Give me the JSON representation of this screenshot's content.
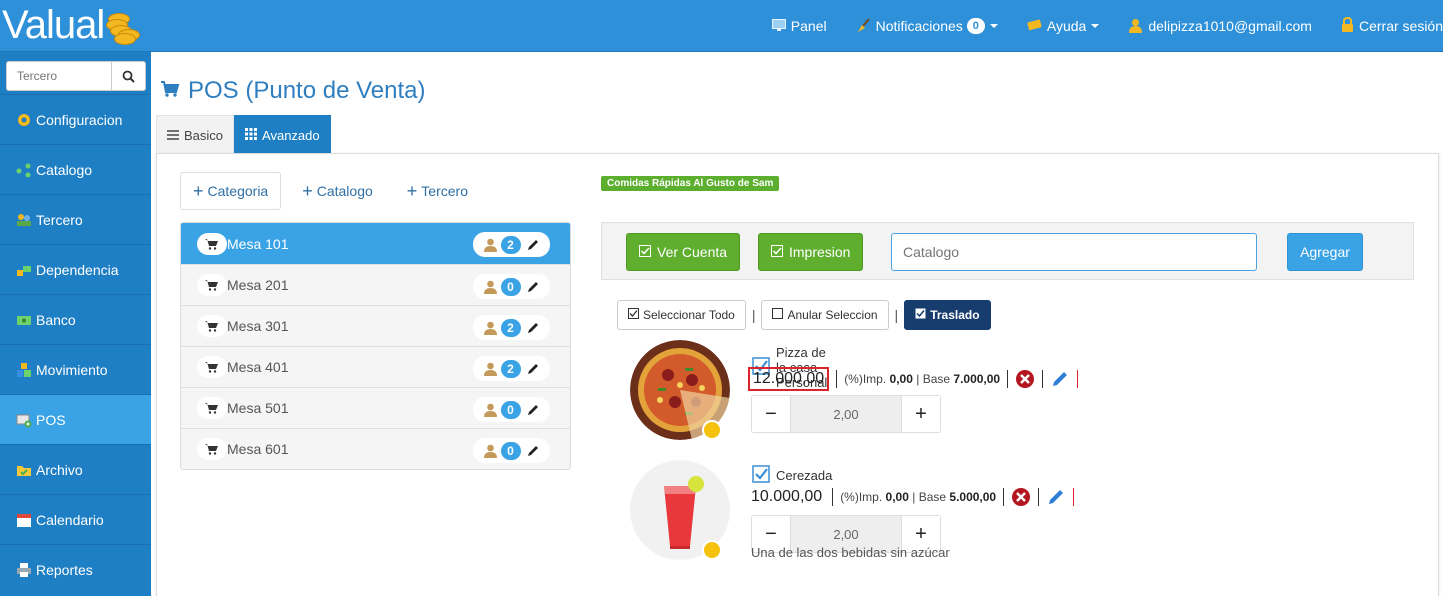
{
  "app": {
    "logo_text": "Valual",
    "colors": {
      "topbar": "#2d90d8",
      "sidebar": "#1f7fc4",
      "active": "#3aa3e6",
      "green": "#5fae2e",
      "dark": "#173d6e",
      "highlight": "#d9232d"
    }
  },
  "topnav": {
    "panel": "Panel",
    "notificaciones": "Notificaciones",
    "notif_count": "0",
    "ayuda": "Ayuda",
    "user": "delipizza1010@gmail.com",
    "logout": "Cerrar sesión"
  },
  "sidebar": {
    "search_placeholder": "Tercero",
    "items": [
      {
        "label": "Configuracion",
        "icon": "gear-icon"
      },
      {
        "label": "Catalogo",
        "icon": "share-icon"
      },
      {
        "label": "Tercero",
        "icon": "users-icon"
      },
      {
        "label": "Dependencia",
        "icon": "blocks-icon"
      },
      {
        "label": "Banco",
        "icon": "money-icon"
      },
      {
        "label": "Movimiento",
        "icon": "cubes-icon"
      },
      {
        "label": "POS",
        "icon": "pos-icon"
      },
      {
        "label": "Archivo",
        "icon": "folder-icon"
      },
      {
        "label": "Calendario",
        "icon": "calendar-icon"
      },
      {
        "label": "Reportes",
        "icon": "printer-icon"
      }
    ],
    "active_index": 6
  },
  "page": {
    "title": "POS (Punto de Venta)",
    "tabs": [
      "Basico",
      "Avanzado"
    ],
    "active_tab": 1
  },
  "left": {
    "add_buttons": [
      "Categoria",
      "Catalogo",
      "Tercero"
    ],
    "mesas": [
      {
        "name": "Mesa 101",
        "count": "2"
      },
      {
        "name": "Mesa 201",
        "count": "0"
      },
      {
        "name": "Mesa 301",
        "count": "2"
      },
      {
        "name": "Mesa 401",
        "count": "2"
      },
      {
        "name": "Mesa 501",
        "count": "0"
      },
      {
        "name": "Mesa 601",
        "count": "0"
      }
    ]
  },
  "right": {
    "store_label": "Comidas Rápidas Al Gusto de Sam",
    "ver_cuenta": "Ver Cuenta",
    "impresion": "Impresion",
    "catalogo_placeholder": "Catalogo",
    "agregar": "Agregar",
    "seleccionar_todo": "Seleccionar Todo",
    "anular_seleccion": "Anular Seleccion",
    "traslado": "Traslado",
    "items": [
      {
        "name": "Pizza de la casa Personal",
        "price": "12.000,00",
        "imp_label": "(%)Imp.",
        "imp": "0,00",
        "base_label": "Base",
        "base": "7.000,00",
        "qty": "2,00",
        "note": ""
      },
      {
        "name": "Cerezada",
        "price": "10.000,00",
        "imp_label": "(%)Imp.",
        "imp": "0,00",
        "base_label": "Base",
        "base": "5.000,00",
        "qty": "2,00",
        "note": "Una de las dos bebidas sin azúcar"
      }
    ]
  }
}
